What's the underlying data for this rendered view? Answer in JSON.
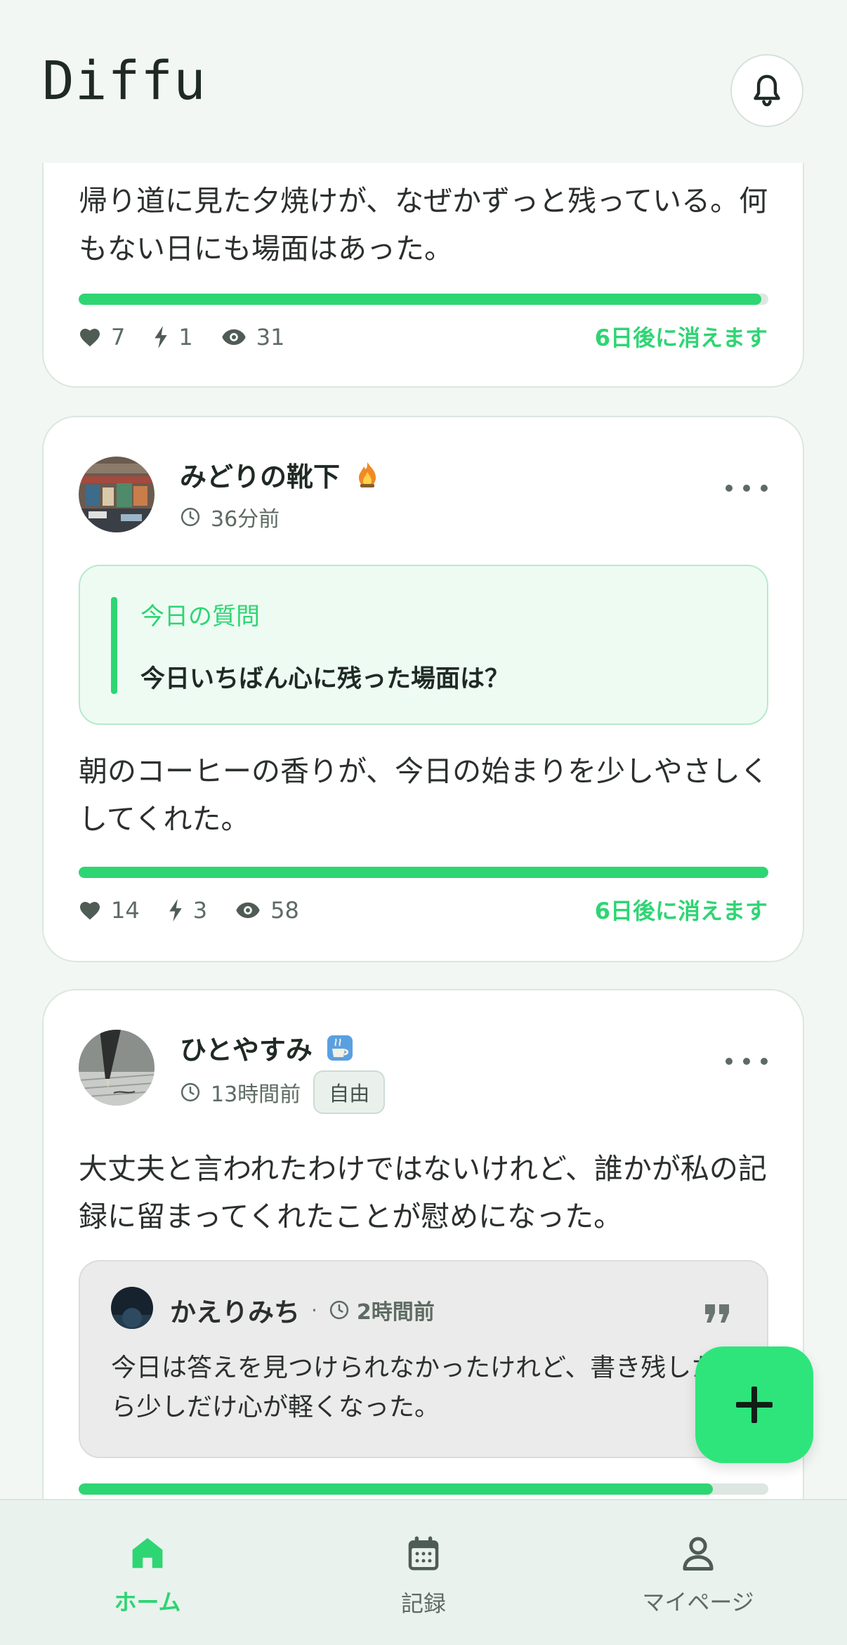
{
  "app": {
    "title": "Diffu"
  },
  "posts": [
    {
      "text": "帰り道に見た夕焼けが、なぜかずっと残っている。何もない日にも場面はあった。",
      "likes": "7",
      "boosts": "1",
      "views": "31",
      "expires": "6日後に消えます",
      "progress": 0.99
    },
    {
      "author": "みどりの靴下",
      "time": "36分前",
      "question_label": "今日の質問",
      "question": "今日いちばん心に残った場面は？",
      "text": "朝のコーヒーの香りが、今日の始まりを少しやさしくしてくれた。",
      "likes": "14",
      "boosts": "3",
      "views": "58",
      "expires": "6日後に消えます",
      "progress": 1.0
    },
    {
      "author": "ひとやすみ",
      "time": "13時間前",
      "tag": "自由",
      "text": "大丈夫と言われたわけではないけれど、誰かが私の記録に留まってくれたことが慰めになった。",
      "quote": {
        "author": "かえりみち",
        "time": "2時間前",
        "text": "今日は答えを見つけられなかったけれど、書き残したら少しだけ心が軽くなった。"
      },
      "progress": 0.92
    }
  ],
  "nav": {
    "home": "ホーム",
    "records": "記録",
    "mypage": "マイページ"
  },
  "colors": {
    "accent": "#2ed573",
    "fab": "#2ee57b"
  }
}
